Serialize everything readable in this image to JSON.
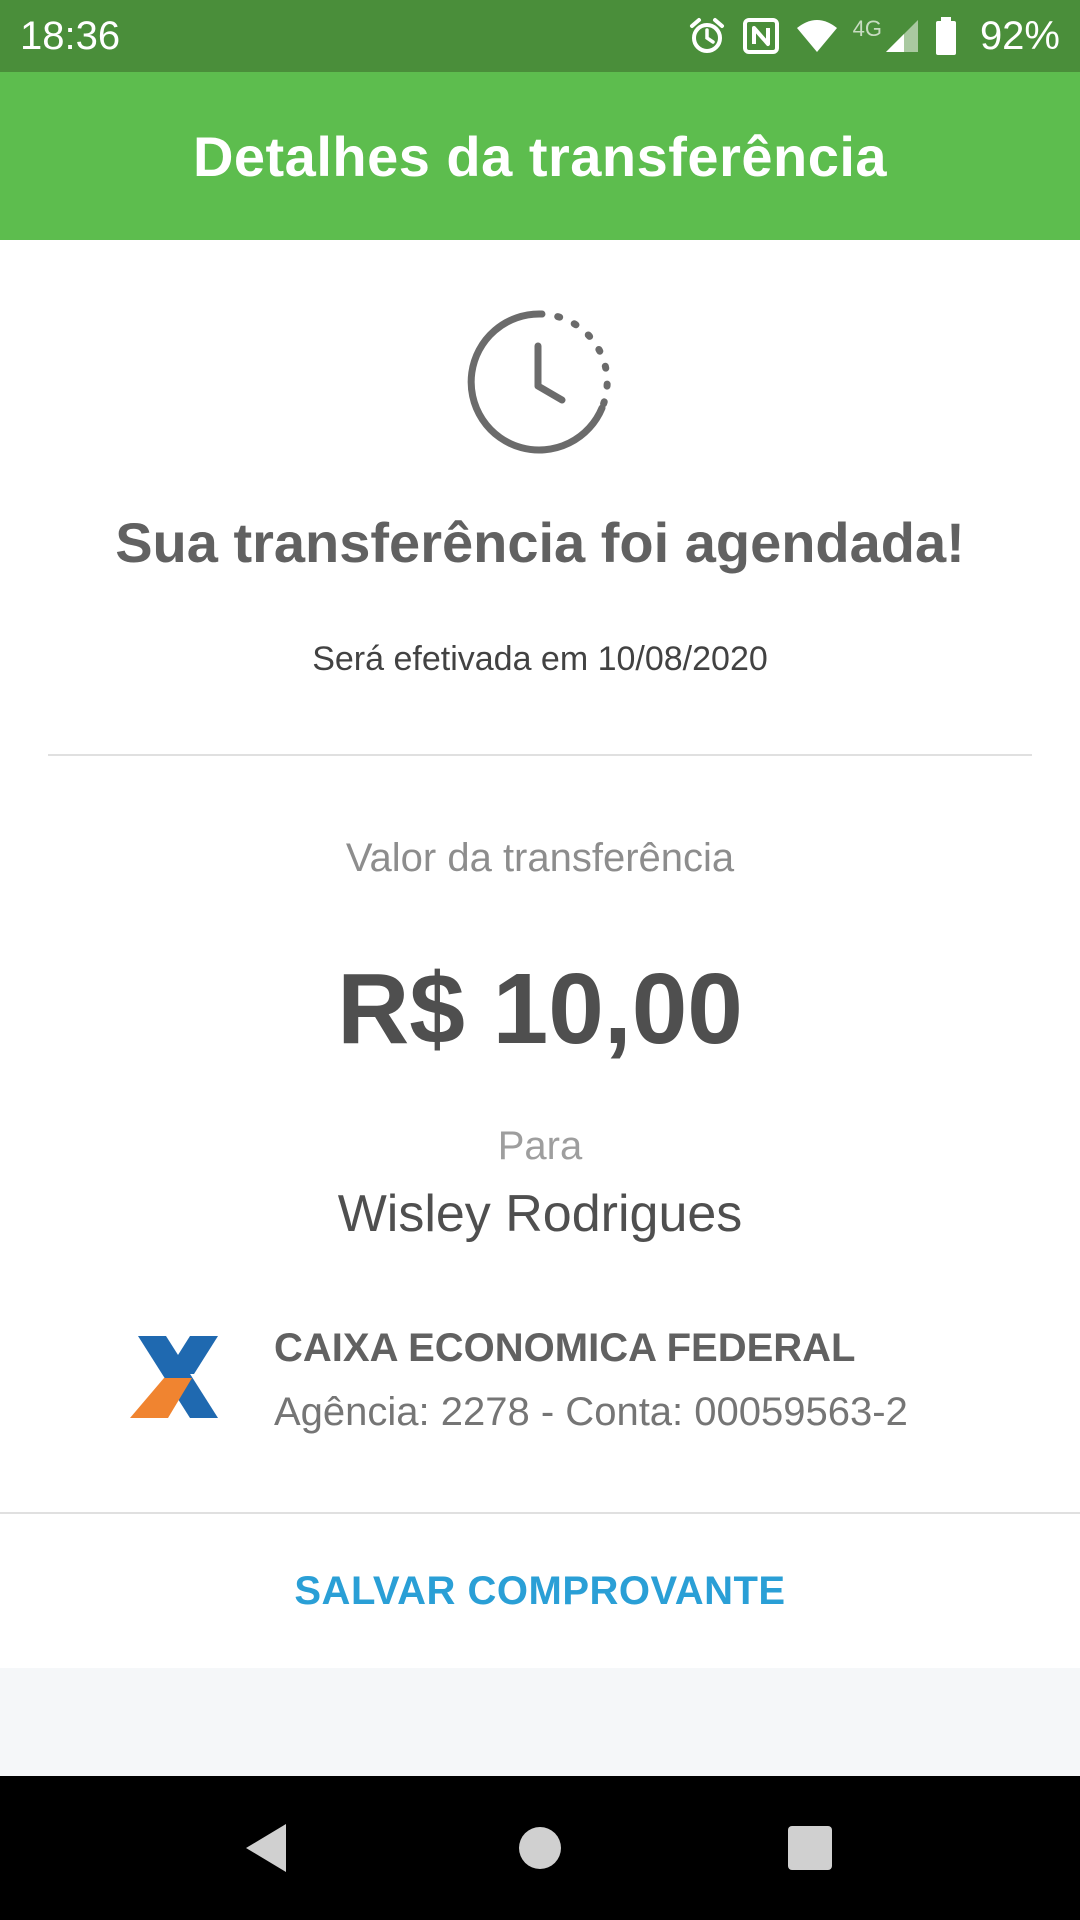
{
  "status_bar": {
    "time": "18:36",
    "network": "4G",
    "battery_percent": "92%",
    "icons": [
      "alarm-icon",
      "nfc-icon",
      "wifi-icon",
      "cell-signal-icon",
      "battery-icon"
    ]
  },
  "header": {
    "title": "Detalhes da transferência",
    "background": "#5dbd4e"
  },
  "status": {
    "icon": "clock-icon",
    "headline": "Sua transferência foi agendada!",
    "scheduled_text": "Será efetivada em 10/08/2020"
  },
  "transfer": {
    "amount_label": "Valor da transferência",
    "amount": "R$ 10,00",
    "to_label": "Para",
    "recipient": "Wisley Rodrigues"
  },
  "bank": {
    "logo": "caixa-logo",
    "name": "CAIXA ECONOMICA FEDERAL",
    "account": "Agência: 2278 - Conta: 00059563-2"
  },
  "actions": {
    "save_label": "SALVAR COMPROVANTE",
    "accent": "#2a9fd6"
  },
  "nav": {
    "icons": [
      "back-icon",
      "home-icon",
      "recents-icon"
    ]
  }
}
